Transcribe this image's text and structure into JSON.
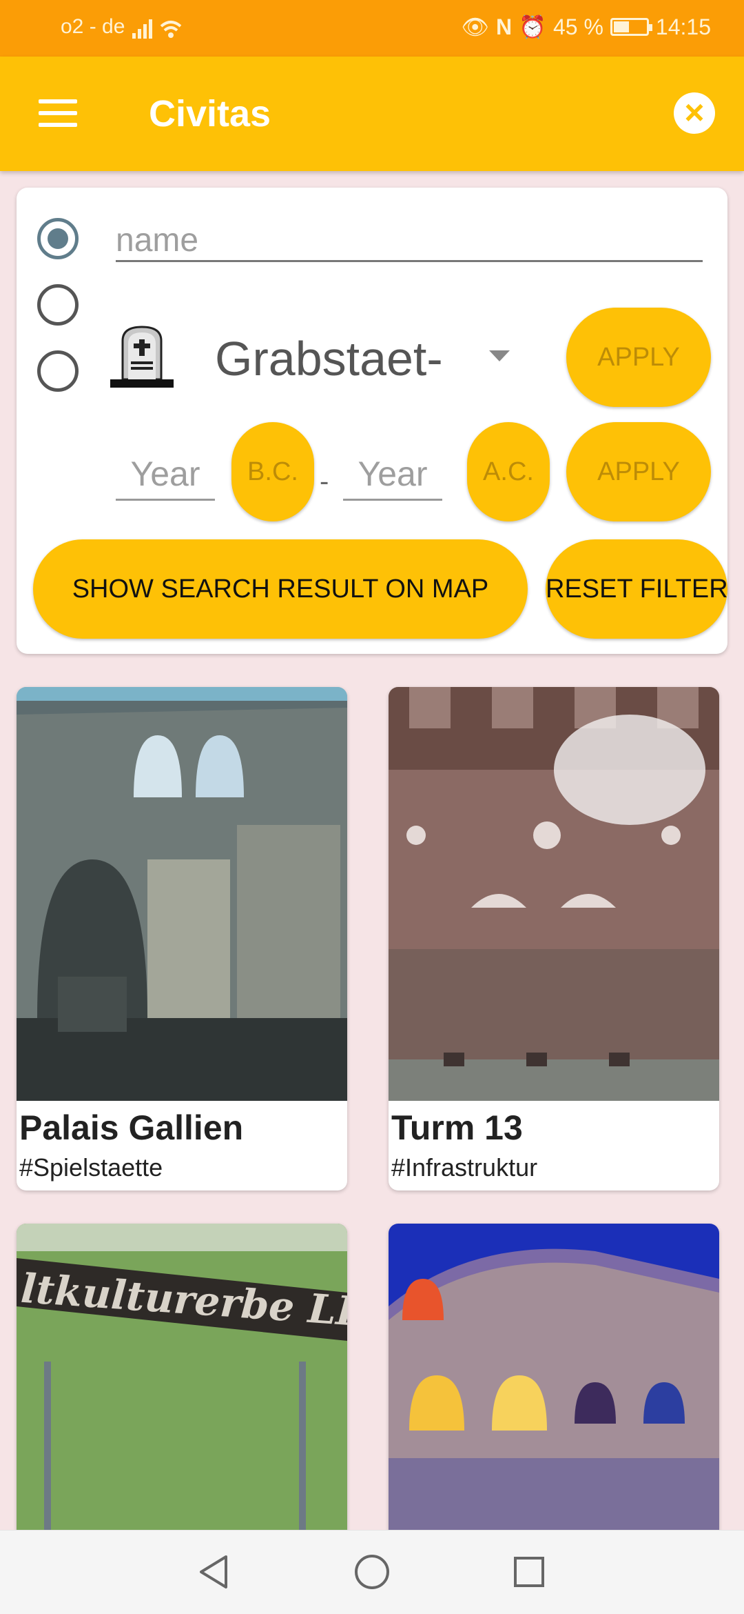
{
  "status": {
    "carrier": "o2 - de",
    "battery": "45 %",
    "battery_level": 0.45,
    "time": "14:15"
  },
  "app": {
    "title": "Civitas"
  },
  "filter": {
    "name_placeholder": "name",
    "category_selected": "Grabstaet-",
    "category_icon": "gravestone-icon",
    "apply_label": "APPLY",
    "year_placeholder": "Year",
    "bc_label": "B.C.",
    "ac_label": "A.C.",
    "dash": "-",
    "show_map_label": "SHOW SEARCH RESULT ON MAP",
    "reset_label": "RESET FILTER",
    "selected_option": "name"
  },
  "results": [
    {
      "title": "Palais Gallien",
      "tag": "#Spielstaette"
    },
    {
      "title": "Turm 13",
      "tag": "#Infrastruktur"
    },
    {
      "title": "",
      "tag": "",
      "image_text": "ltkulturerbe LI"
    },
    {
      "title": "",
      "tag": ""
    }
  ],
  "colors": {
    "status_bar": "#fb9d06",
    "app_bar": "#fec106",
    "accent": "#fec106",
    "background": "#f6e4e6"
  }
}
